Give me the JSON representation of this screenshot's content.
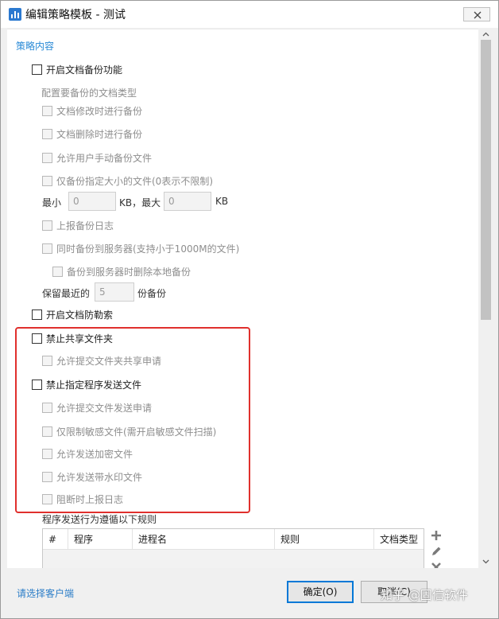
{
  "window": {
    "title": "编辑策略模板 - 测试"
  },
  "section": {
    "title": "策略内容"
  },
  "options": {
    "backup_enable": "开启文档备份功能",
    "backup_config_label": "配置要备份的文档类型",
    "backup_on_modify": "文档修改时进行备份",
    "backup_on_delete": "文档删除时进行备份",
    "allow_manual_backup": "允许用户手动备份文件",
    "backup_size_limit": "仅备份指定大小的文件(0表示不限制)",
    "min_label": "最小",
    "min_value": "0",
    "kb_max_label": "KB，最大",
    "max_value": "0",
    "kb_label": "KB",
    "report_backup_log": "上报备份日志",
    "backup_to_server": "同时备份到服务器(支持小于1000M的文件)",
    "delete_local_after_server": "备份到服务器时删除本地备份",
    "keep_recent_label": "保留最近的",
    "keep_recent_value": "5",
    "copies_label": "份备份",
    "anti_ransomware": "开启文档防勒索",
    "forbid_shared_folder": "禁止共享文件夹",
    "allow_share_request": "允许提交文件夹共享申请",
    "forbid_program_send": "禁止指定程序发送文件",
    "allow_send_request": "允许提交文件发送申请",
    "limit_sensitive": "仅限制敏感文件(需开启敏感文件扫描)",
    "allow_send_encrypted": "允许发送加密文件",
    "allow_send_watermark": "允许发送带水印文件",
    "report_on_block": "阻断时上报日志"
  },
  "rules": {
    "title": "程序发送行为遵循以下规则",
    "columns": [
      "#",
      "程序",
      "进程名",
      "规则",
      "文档类型"
    ]
  },
  "footer": {
    "select_client": "请选择客户端",
    "ok": "确定(O)",
    "cancel": "取消(C)"
  },
  "watermark": "知乎 @固信软件",
  "colors": {
    "accent": "#2a8ad6",
    "highlight_border": "#e0302d"
  },
  "icons": [
    "chart-app-icon",
    "close-icon",
    "add-icon",
    "edit-icon",
    "delete-icon",
    "scroll-up-icon",
    "scroll-down-icon"
  ]
}
